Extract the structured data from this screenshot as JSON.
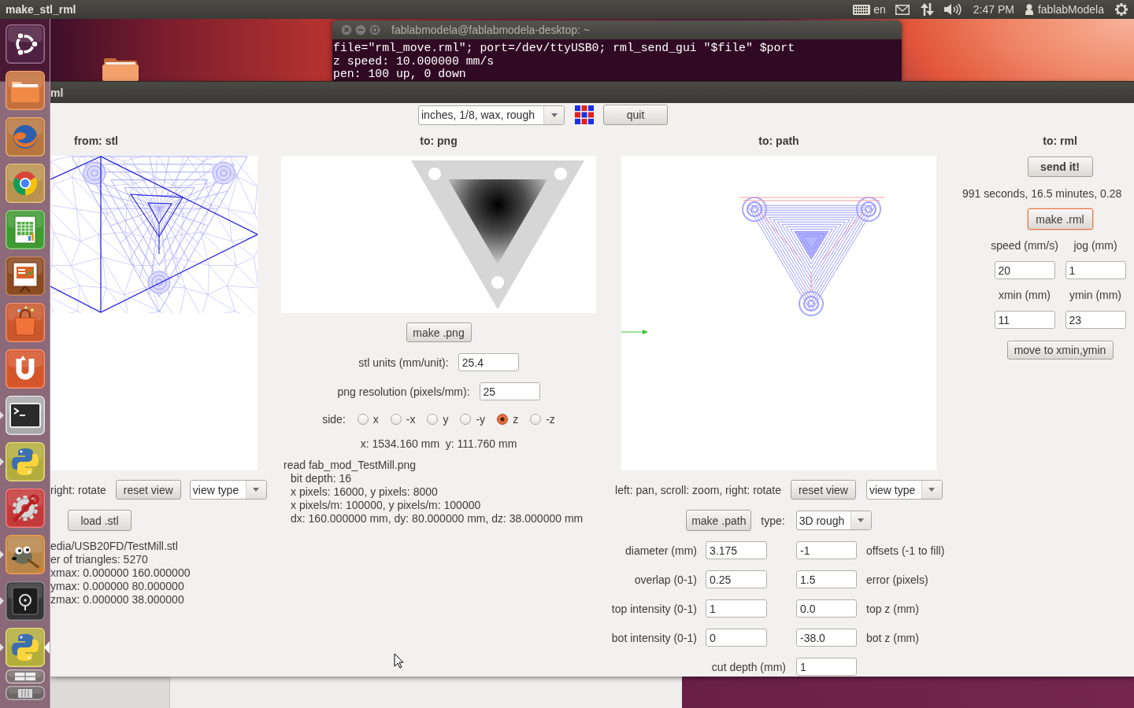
{
  "top_panel": {
    "app_title": "make_stl_rml",
    "keyboard_layout": "en",
    "clock": "2:47 PM",
    "user": "fablabModela"
  },
  "launcher": {
    "items": [
      {
        "kind": "dash",
        "running": false,
        "active": false
      },
      {
        "kind": "files",
        "running": false,
        "active": false
      },
      {
        "kind": "firefox",
        "running": false,
        "active": false
      },
      {
        "kind": "chrome",
        "running": false,
        "active": false
      },
      {
        "kind": "calc",
        "running": false,
        "active": false
      },
      {
        "kind": "impress",
        "running": false,
        "active": false
      },
      {
        "kind": "store",
        "running": false,
        "active": false
      },
      {
        "kind": "cloud",
        "running": false,
        "active": false
      },
      {
        "kind": "terminal",
        "running": true,
        "active": false
      },
      {
        "kind": "python",
        "running": true,
        "active": false
      },
      {
        "kind": "tools",
        "running": false,
        "active": false
      },
      {
        "kind": "gimp",
        "running": true,
        "active": false
      },
      {
        "kind": "safe",
        "running": true,
        "active": false
      },
      {
        "kind": "python",
        "running": true,
        "active": true
      },
      {
        "kind": "workspaces",
        "running": false,
        "active": false
      },
      {
        "kind": "trash",
        "running": false,
        "active": false
      }
    ]
  },
  "terminal": {
    "title": "fablabmodela@fablabmodela-desktop: ~",
    "lines": [
      "file=\"rml_move.rml\"; port=/dev/ttyUSB0; rml_send_gui \"$file\" $port",
      "z speed: 10.000000 mm/s",
      "pen: 100 up, 0 down"
    ]
  },
  "app_window": {
    "title": "ml",
    "preset": "inches, 1/8, wax, rough",
    "quit": "quit",
    "stl": {
      "heading": "from: stl",
      "hint": "right: rotate",
      "reset": "reset view",
      "view_type": "view type",
      "load": "load .stl",
      "info": [
        "edia/USB20FD/TestMill.stl",
        "er of triangles: 5270",
        "xmax: 0.000000 160.000000",
        "ymax: 0.000000 80.000000",
        "zmax: 0.000000 38.000000"
      ]
    },
    "png": {
      "heading": "to: png",
      "make": "make .png",
      "fields": [
        {
          "label": "stl units (mm/unit):",
          "value": "25.4"
        },
        {
          "label": "png resolution (pixels/mm):",
          "value": "25"
        }
      ],
      "side": {
        "label": "side:",
        "options": [
          {
            "label": "x",
            "selected": false
          },
          {
            "label": "-x",
            "selected": false
          },
          {
            "label": "y",
            "selected": false
          },
          {
            "label": "-y",
            "selected": false
          },
          {
            "label": "z",
            "selected": true
          },
          {
            "label": "-z",
            "selected": false
          }
        ]
      },
      "size": "x: 1534.160 mm  y: 111.760 mm",
      "info": {
        "title": "read fab_mod_TestMill.png",
        "details": [
          "bit depth: 16",
          "x pixels: 16000, y pixels: 8000",
          "x pixels/m: 100000, y pixels/m: 100000",
          "dx: 160.000000 mm, dy: 80.000000 mm, dz: 38.000000 mm"
        ]
      }
    },
    "path": {
      "heading": "to: path",
      "hint": "left: pan, scroll: zoom, right: rotate",
      "reset": "reset view",
      "view_type": "view type",
      "make": "make .path",
      "type_label": "type:",
      "type": "3D rough",
      "params": [
        {
          "left": {
            "label": "diameter (mm)",
            "value": "3.175"
          },
          "right": {
            "value": "-1",
            "label": "offsets (-1 to fill)"
          }
        },
        {
          "left": {
            "label": "overlap (0-1)",
            "value": "0.25"
          },
          "right": {
            "value": "1.5",
            "label": "error (pixels)"
          }
        },
        {
          "left": {
            "label": "top intensity (0-1)",
            "value": "1"
          },
          "right": {
            "value": "0.0",
            "label": "top z (mm)"
          }
        },
        {
          "left": {
            "label": "bot intensity (0-1)",
            "value": "0"
          },
          "right": {
            "value": "-38.0",
            "label": "bot z (mm)"
          }
        }
      ],
      "cut_depth": {
        "label": "cut depth (mm)",
        "value": "1"
      }
    },
    "rml": {
      "heading": "to: rml",
      "send": "send it!",
      "estimate": "991 seconds, 16.5 minutes, 0.28",
      "make": {
        "label": "make .rml",
        "focused": true
      },
      "fields": [
        {
          "label": "speed (mm/s)",
          "value": "20"
        },
        {
          "label": "jog (mm)",
          "value": "1"
        },
        {
          "label": "xmin (mm)",
          "value": "11"
        },
        {
          "label": "ymin (mm)",
          "value": "23"
        }
      ],
      "move": "move to xmin,ymin"
    }
  }
}
